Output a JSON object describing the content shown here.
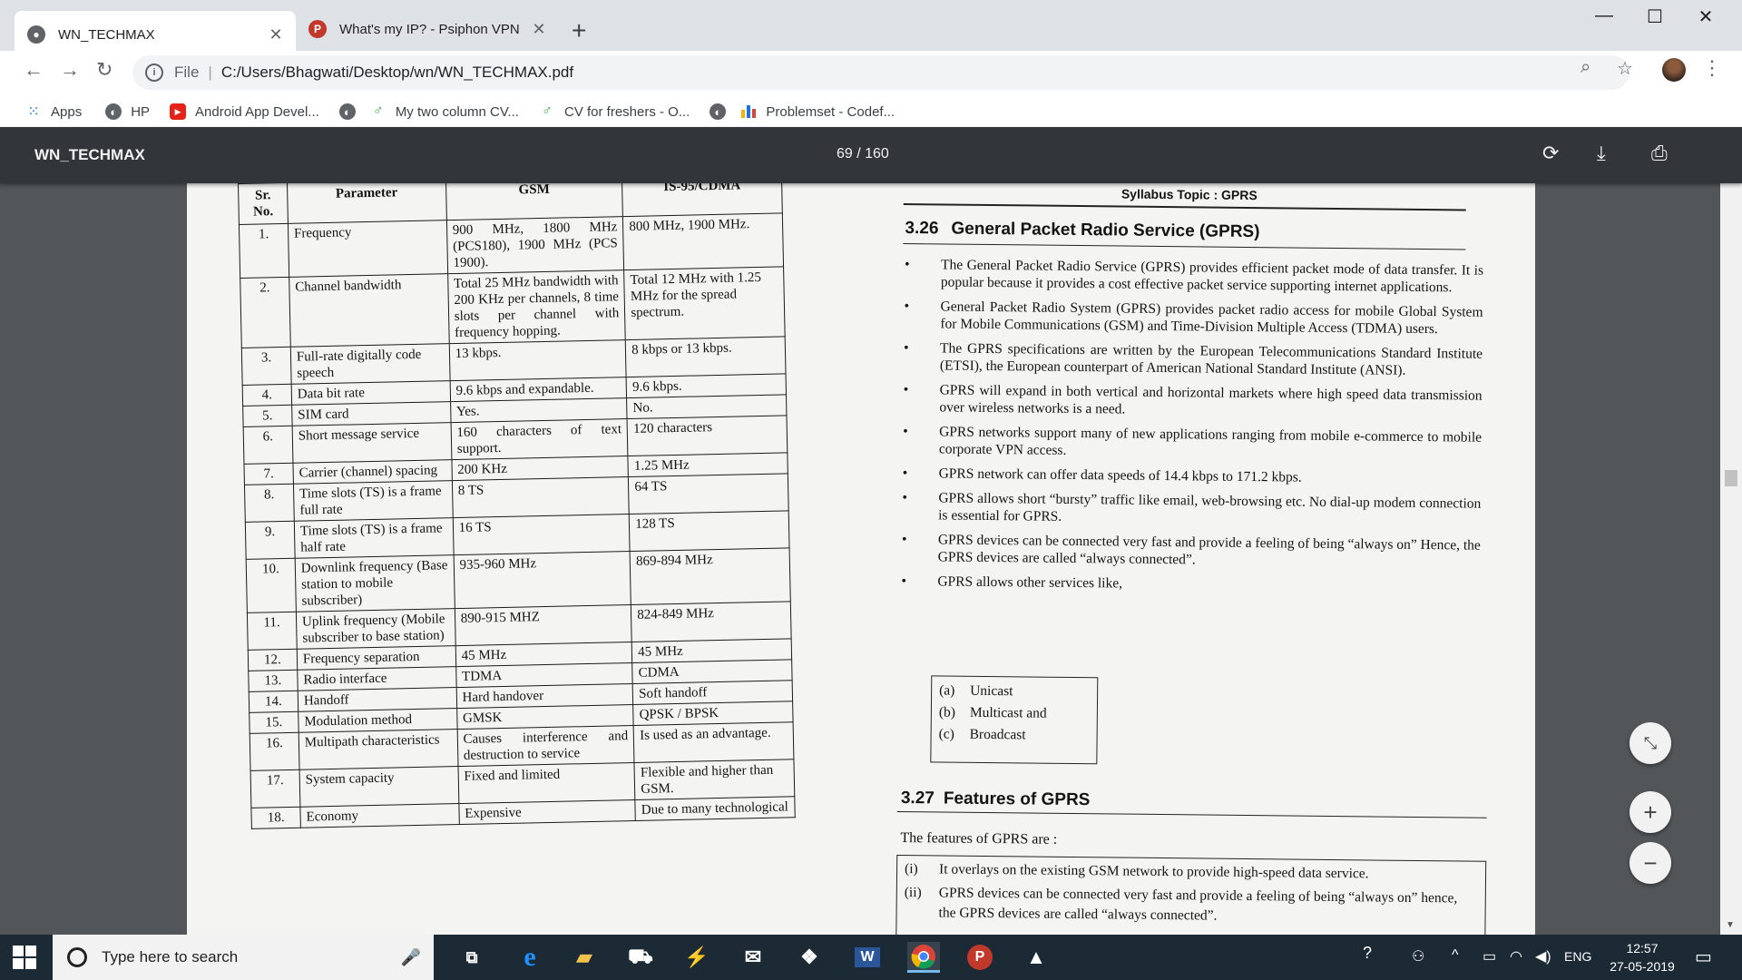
{
  "browser": {
    "tabs": [
      {
        "title": "WN_TECHMAX",
        "active": true
      },
      {
        "title": "What's my IP? - Psiphon VPN",
        "active": false
      }
    ],
    "address": {
      "scheme_label": "File",
      "url": "C:/Users/Bhagwati/Desktop/wn/WN_TECHMAX.pdf"
    },
    "bookmarks": [
      {
        "label": "Apps",
        "icon": "apps-grid-icon"
      },
      {
        "label": "HP",
        "icon": "globe-icon"
      },
      {
        "label": "Android App Devel...",
        "icon": "youtube-icon"
      },
      {
        "label": "",
        "icon": "globe-icon"
      },
      {
        "label": "My two column CV...",
        "icon": "overleaf-icon"
      },
      {
        "label": "CV for freshers - O...",
        "icon": "overleaf-icon"
      },
      {
        "label": "",
        "icon": "globe-icon"
      },
      {
        "label": "Problemset - Codef...",
        "icon": "codeforces-icon"
      }
    ]
  },
  "pdf": {
    "title": "WN_TECHMAX",
    "page_indicator": "69 / 160",
    "left": {
      "table_headers": [
        "Sr. No.",
        "Parameter",
        "GSM",
        "IS-95/CDMA"
      ],
      "rows": [
        {
          "sr": "1.",
          "param": "Frequency",
          "gsm": "900 MHz, 1800 MHz (PCS180), 1900 MHz (PCS 1900).",
          "cdma": "800 MHz, 1900 MHz."
        },
        {
          "sr": "2.",
          "param": "Channel bandwidth",
          "gsm": "Total 25 MHz bandwidth with 200 KHz per channels, 8 time slots per channel with frequency hopping.",
          "cdma": "Total 12 MHz with 1.25 MHz for the spread spectrum."
        },
        {
          "sr": "3.",
          "param": "Full-rate digitally code speech",
          "gsm": "13 kbps.",
          "cdma": "8 kbps or 13 kbps."
        },
        {
          "sr": "4.",
          "param": "Data bit rate",
          "gsm": "9.6 kbps and expandable.",
          "cdma": "9.6 kbps."
        },
        {
          "sr": "5.",
          "param": "SIM card",
          "gsm": "Yes.",
          "cdma": "No."
        },
        {
          "sr": "6.",
          "param": "Short message service",
          "gsm": "160 characters of text support.",
          "cdma": "120 characters"
        },
        {
          "sr": "7.",
          "param": "Carrier (channel) spacing",
          "gsm": "200 KHz",
          "cdma": "1.25 MHz"
        },
        {
          "sr": "8.",
          "param": "Time slots (TS) is a frame full rate",
          "gsm": "8 TS",
          "cdma": "64 TS"
        },
        {
          "sr": "9.",
          "param": "Time slots (TS) is a frame half rate",
          "gsm": "16 TS",
          "cdma": "128 TS"
        },
        {
          "sr": "10.",
          "param": "Downlink frequency (Base station to mobile subscriber)",
          "gsm": "935-960 MHz",
          "cdma": "869-894 MHz"
        },
        {
          "sr": "11.",
          "param": "Uplink frequency (Mobile subscriber to base station)",
          "gsm": "890-915 MHZ",
          "cdma": "824-849 MHz"
        },
        {
          "sr": "12.",
          "param": "Frequency separation",
          "gsm": "45 MHz",
          "cdma": "45 MHz"
        },
        {
          "sr": "13.",
          "param": "Radio interface",
          "gsm": "TDMA",
          "cdma": "CDMA"
        },
        {
          "sr": "14.",
          "param": "Handoff",
          "gsm": "Hard handover",
          "cdma": "Soft handoff"
        },
        {
          "sr": "15.",
          "param": "Modulation method",
          "gsm": "GMSK",
          "cdma": "QPSK / BPSK"
        },
        {
          "sr": "16.",
          "param": "Multipath characteristics",
          "gsm": "Causes interference and destruction to service",
          "cdma": "Is used as an advantage."
        },
        {
          "sr": "17.",
          "param": "System capacity",
          "gsm": "Fixed and limited",
          "cdma": "Flexible and higher than GSM."
        },
        {
          "sr": "18.",
          "param": "Economy",
          "gsm": "Expensive",
          "cdma": "Due to many technological"
        }
      ]
    },
    "right": {
      "syllabus": "Syllabus Topic : GPRS",
      "section1": {
        "num": "3.26",
        "title": "General Packet Radio Service (GPRS)"
      },
      "bullets": [
        "The General Packet Radio Service (GPRS) provides efficient packet mode of data transfer. It is popular because it provides a cost effective packet service supporting internet applications.",
        "General Packet Radio System (GPRS) provides packet radio access for mobile Global System for Mobile Communications (GSM) and Time-Division Multiple Access (TDMA) users.",
        "The GPRS specifications are written by the European Telecommunications Standard Institute (ETSI), the European counterpart of American National Standard Institute (ANSI).",
        "GPRS will expand in both vertical and horizontal markets where high speed data transmission over wireless networks is a need.",
        "GPRS networks support many of new applications ranging from mobile e-commerce to mobile corporate VPN access.",
        "GPRS network can offer data speeds of 14.4 kbps to 171.2 kbps.",
        "GPRS allows short “bursty” traffic like email, web-browsing etc. No dial-up modem connection is essential for GPRS.",
        "GPRS devices can be connected very fast and provide a feeling of being “always on” Hence, the GPRS devices are called “always connected”.",
        "GPRS allows other services like,"
      ],
      "services": [
        {
          "label": "(a)",
          "text": "Unicast"
        },
        {
          "label": "(b)",
          "text": "Multicast and"
        },
        {
          "label": "(c)",
          "text": "Broadcast"
        }
      ],
      "section2": {
        "num": "3.27",
        "title": "Features of GPRS"
      },
      "features_intro": "The features of GPRS are :",
      "features": [
        {
          "label": "(i)",
          "text": "It overlays on the existing GSM network to provide high-speed data service."
        },
        {
          "label": "(ii)",
          "text": "GPRS devices can be connected very fast and provide a feeling of being “always on” hence, the GPRS devices are called “always connected”."
        }
      ]
    }
  },
  "taskbar": {
    "search_placeholder": "Type here to search",
    "language": "ENG",
    "time": "12:57",
    "date": "27-05-2019"
  }
}
